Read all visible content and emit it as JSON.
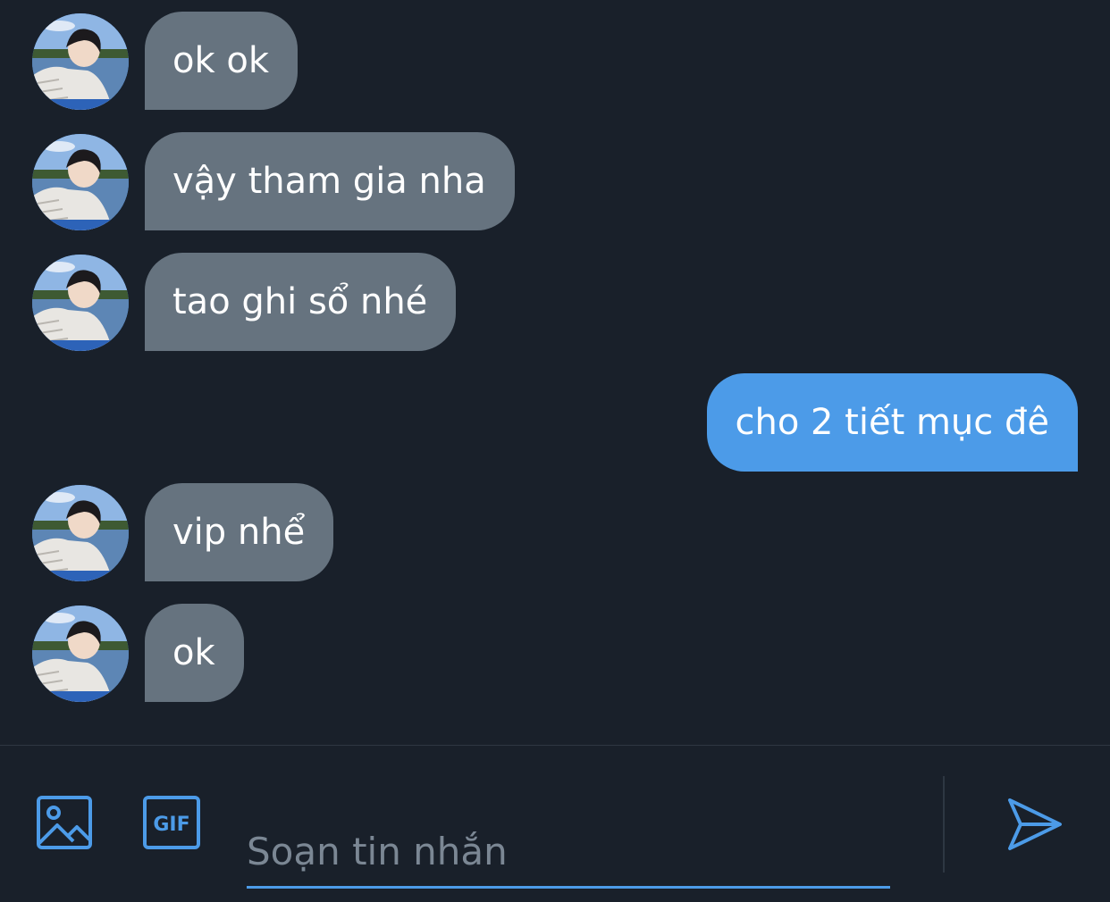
{
  "colors": {
    "background": "#19202a",
    "incoming_bubble": "#66737f",
    "outgoing_bubble": "#4c9be8",
    "accent": "#4c9be8"
  },
  "messages": [
    {
      "direction": "incoming",
      "text": "ok ok"
    },
    {
      "direction": "incoming",
      "text": "vậy tham gia nha"
    },
    {
      "direction": "incoming",
      "text": "tao ghi sổ nhé"
    },
    {
      "direction": "outgoing",
      "text": "cho 2 tiết mục đê"
    },
    {
      "direction": "incoming",
      "text": "vip nhể"
    },
    {
      "direction": "incoming",
      "text": "ok"
    }
  ],
  "composer": {
    "placeholder": "Soạn tin nhắn",
    "value": "",
    "image_icon": "image-icon",
    "gif_icon": "gif-icon",
    "gif_label": "GIF",
    "send_icon": "send-icon"
  }
}
